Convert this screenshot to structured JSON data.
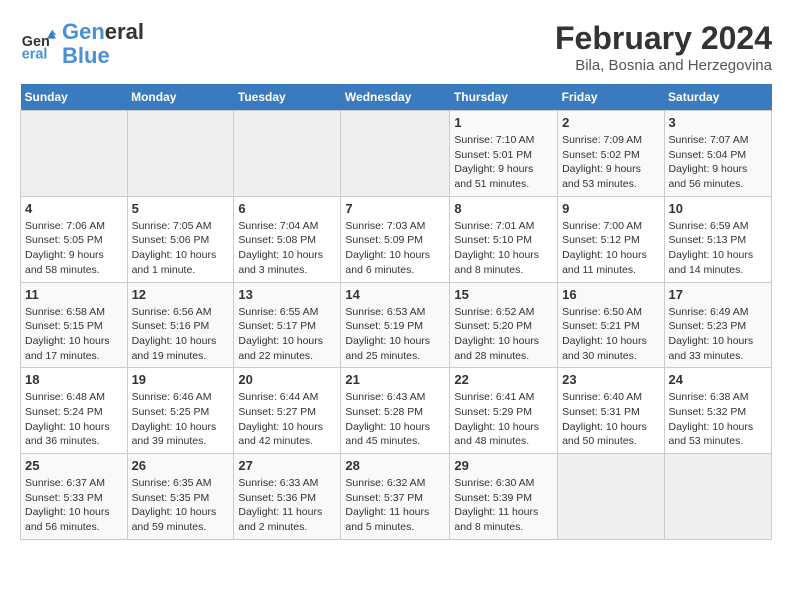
{
  "header": {
    "logo_line1": "General",
    "logo_line2": "Blue",
    "title": "February 2024",
    "subtitle": "Bila, Bosnia and Herzegovina"
  },
  "weekdays": [
    "Sunday",
    "Monday",
    "Tuesday",
    "Wednesday",
    "Thursday",
    "Friday",
    "Saturday"
  ],
  "weeks": [
    [
      {
        "num": "",
        "info": "",
        "empty": true
      },
      {
        "num": "",
        "info": "",
        "empty": true
      },
      {
        "num": "",
        "info": "",
        "empty": true
      },
      {
        "num": "",
        "info": "",
        "empty": true
      },
      {
        "num": "1",
        "info": "Sunrise: 7:10 AM\nSunset: 5:01 PM\nDaylight: 9 hours and 51 minutes."
      },
      {
        "num": "2",
        "info": "Sunrise: 7:09 AM\nSunset: 5:02 PM\nDaylight: 9 hours and 53 minutes."
      },
      {
        "num": "3",
        "info": "Sunrise: 7:07 AM\nSunset: 5:04 PM\nDaylight: 9 hours and 56 minutes."
      }
    ],
    [
      {
        "num": "4",
        "info": "Sunrise: 7:06 AM\nSunset: 5:05 PM\nDaylight: 9 hours and 58 minutes."
      },
      {
        "num": "5",
        "info": "Sunrise: 7:05 AM\nSunset: 5:06 PM\nDaylight: 10 hours and 1 minute."
      },
      {
        "num": "6",
        "info": "Sunrise: 7:04 AM\nSunset: 5:08 PM\nDaylight: 10 hours and 3 minutes."
      },
      {
        "num": "7",
        "info": "Sunrise: 7:03 AM\nSunset: 5:09 PM\nDaylight: 10 hours and 6 minutes."
      },
      {
        "num": "8",
        "info": "Sunrise: 7:01 AM\nSunset: 5:10 PM\nDaylight: 10 hours and 8 minutes."
      },
      {
        "num": "9",
        "info": "Sunrise: 7:00 AM\nSunset: 5:12 PM\nDaylight: 10 hours and 11 minutes."
      },
      {
        "num": "10",
        "info": "Sunrise: 6:59 AM\nSunset: 5:13 PM\nDaylight: 10 hours and 14 minutes."
      }
    ],
    [
      {
        "num": "11",
        "info": "Sunrise: 6:58 AM\nSunset: 5:15 PM\nDaylight: 10 hours and 17 minutes."
      },
      {
        "num": "12",
        "info": "Sunrise: 6:56 AM\nSunset: 5:16 PM\nDaylight: 10 hours and 19 minutes."
      },
      {
        "num": "13",
        "info": "Sunrise: 6:55 AM\nSunset: 5:17 PM\nDaylight: 10 hours and 22 minutes."
      },
      {
        "num": "14",
        "info": "Sunrise: 6:53 AM\nSunset: 5:19 PM\nDaylight: 10 hours and 25 minutes."
      },
      {
        "num": "15",
        "info": "Sunrise: 6:52 AM\nSunset: 5:20 PM\nDaylight: 10 hours and 28 minutes."
      },
      {
        "num": "16",
        "info": "Sunrise: 6:50 AM\nSunset: 5:21 PM\nDaylight: 10 hours and 30 minutes."
      },
      {
        "num": "17",
        "info": "Sunrise: 6:49 AM\nSunset: 5:23 PM\nDaylight: 10 hours and 33 minutes."
      }
    ],
    [
      {
        "num": "18",
        "info": "Sunrise: 6:48 AM\nSunset: 5:24 PM\nDaylight: 10 hours and 36 minutes."
      },
      {
        "num": "19",
        "info": "Sunrise: 6:46 AM\nSunset: 5:25 PM\nDaylight: 10 hours and 39 minutes."
      },
      {
        "num": "20",
        "info": "Sunrise: 6:44 AM\nSunset: 5:27 PM\nDaylight: 10 hours and 42 minutes."
      },
      {
        "num": "21",
        "info": "Sunrise: 6:43 AM\nSunset: 5:28 PM\nDaylight: 10 hours and 45 minutes."
      },
      {
        "num": "22",
        "info": "Sunrise: 6:41 AM\nSunset: 5:29 PM\nDaylight: 10 hours and 48 minutes."
      },
      {
        "num": "23",
        "info": "Sunrise: 6:40 AM\nSunset: 5:31 PM\nDaylight: 10 hours and 50 minutes."
      },
      {
        "num": "24",
        "info": "Sunrise: 6:38 AM\nSunset: 5:32 PM\nDaylight: 10 hours and 53 minutes."
      }
    ],
    [
      {
        "num": "25",
        "info": "Sunrise: 6:37 AM\nSunset: 5:33 PM\nDaylight: 10 hours and 56 minutes."
      },
      {
        "num": "26",
        "info": "Sunrise: 6:35 AM\nSunset: 5:35 PM\nDaylight: 10 hours and 59 minutes."
      },
      {
        "num": "27",
        "info": "Sunrise: 6:33 AM\nSunset: 5:36 PM\nDaylight: 11 hours and 2 minutes."
      },
      {
        "num": "28",
        "info": "Sunrise: 6:32 AM\nSunset: 5:37 PM\nDaylight: 11 hours and 5 minutes."
      },
      {
        "num": "29",
        "info": "Sunrise: 6:30 AM\nSunset: 5:39 PM\nDaylight: 11 hours and 8 minutes."
      },
      {
        "num": "",
        "info": "",
        "empty": true
      },
      {
        "num": "",
        "info": "",
        "empty": true
      }
    ]
  ]
}
